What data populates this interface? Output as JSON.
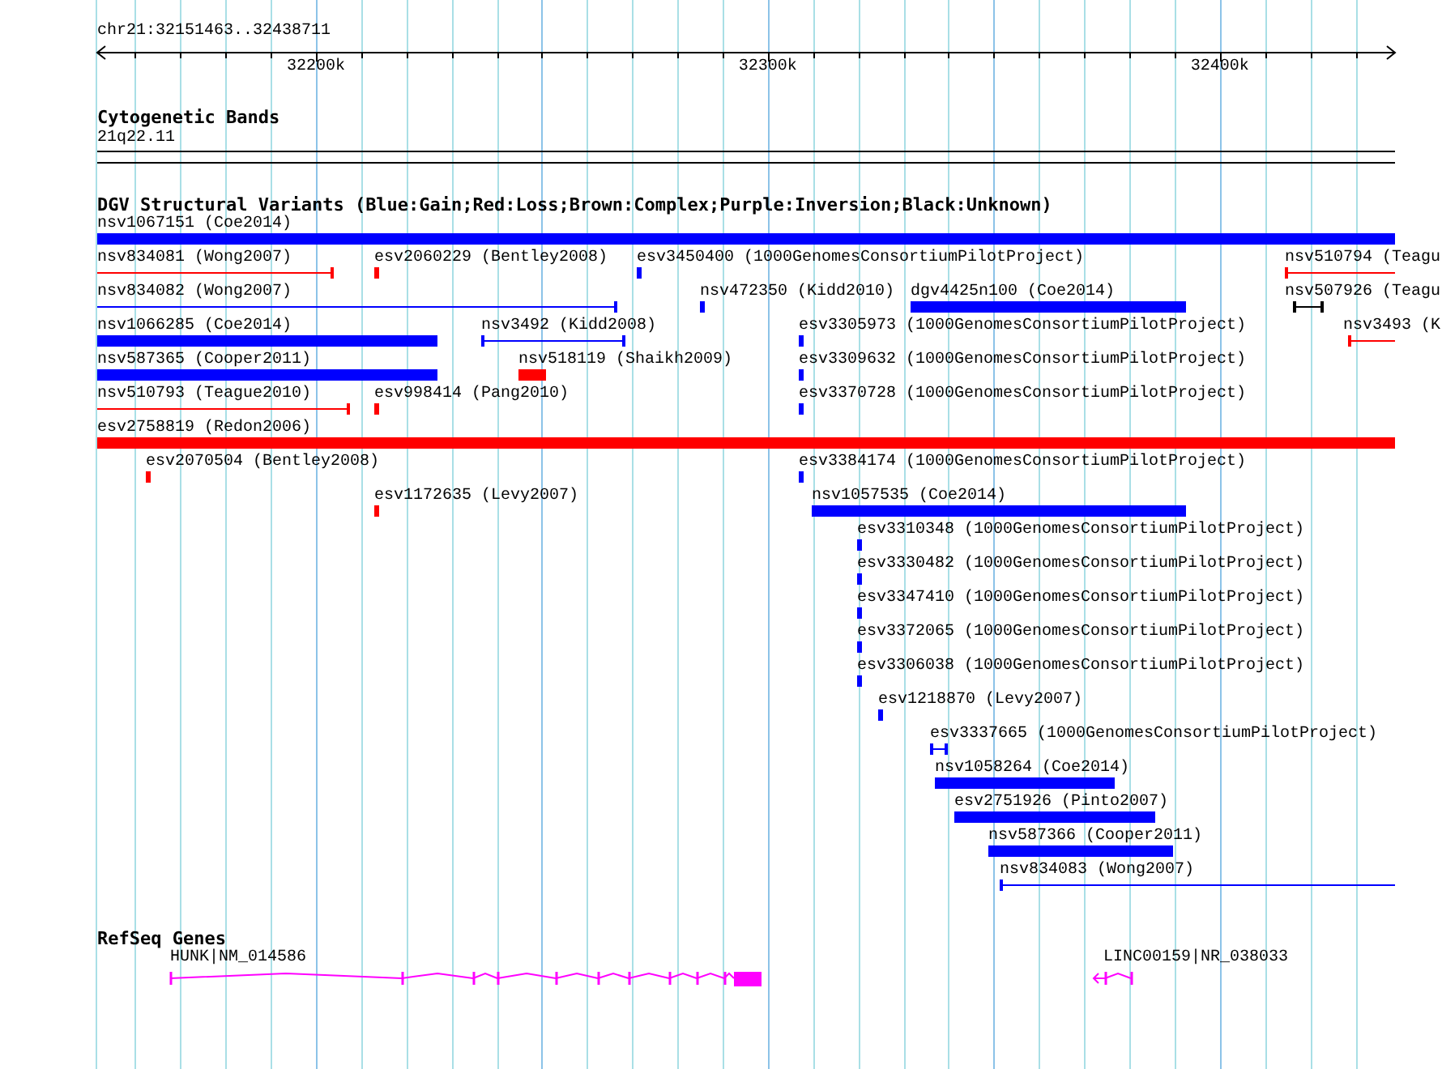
{
  "ruler": {
    "region": "chr21:32151463..32438711",
    "ticks": [
      "32200k",
      "32300k",
      "32400k"
    ]
  },
  "cytoband_track": {
    "title": "Cytogenetic Bands",
    "band": "21q22.11"
  },
  "variants_track": {
    "title": "DGV Structural Variants (Blue:Gain;Red:Loss;Brown:Complex;Purple:Inversion;Black:Unknown)",
    "rows": [
      {
        "features": [
          {
            "label": "nsv1067151 (Coe2014)",
            "color": "#0000ff",
            "kind": "bar"
          }
        ]
      },
      {
        "features": [
          {
            "label": "nsv834081 (Wong2007)",
            "color": "#ff0000",
            "kind": "span"
          },
          {
            "label": "esv2060229 (Bentley2008)",
            "color": "#ff0000",
            "kind": "bar"
          },
          {
            "label": "esv3450400 (1000GenomesConsortiumPilotProject)",
            "color": "#0000ff",
            "kind": "bar"
          },
          {
            "label": "nsv510794 (Teagu",
            "color": "#ff0000",
            "kind": "span"
          }
        ]
      },
      {
        "features": [
          {
            "label": "nsv834082 (Wong2007)",
            "color": "#0000ff",
            "kind": "span"
          },
          {
            "label": "nsv472350 (Kidd2010)",
            "color": "#0000ff",
            "kind": "bar"
          },
          {
            "label": "dgv4425n100 (Coe2014)",
            "color": "#0000ff",
            "kind": "bar"
          },
          {
            "label": "nsv507926 (Teagu",
            "color": "#000000",
            "kind": "span"
          }
        ]
      },
      {
        "features": [
          {
            "label": "nsv1066285 (Coe2014)",
            "color": "#0000ff",
            "kind": "bar"
          },
          {
            "label": "nsv3492 (Kidd2008)",
            "color": "#0000ff",
            "kind": "span"
          },
          {
            "label": "esv3305973 (1000GenomesConsortiumPilotProject)",
            "color": "#0000ff",
            "kind": "bar"
          },
          {
            "label": "nsv3493 (K",
            "color": "#ff0000",
            "kind": "span"
          }
        ]
      },
      {
        "features": [
          {
            "label": "nsv587365 (Cooper2011)",
            "color": "#0000ff",
            "kind": "bar"
          },
          {
            "label": "nsv518119 (Shaikh2009)",
            "color": "#ff0000",
            "kind": "bar"
          },
          {
            "label": "esv3309632 (1000GenomesConsortiumPilotProject)",
            "color": "#0000ff",
            "kind": "bar"
          }
        ]
      },
      {
        "features": [
          {
            "label": "nsv510793 (Teague2010)",
            "color": "#ff0000",
            "kind": "span"
          },
          {
            "label": "esv998414 (Pang2010)",
            "color": "#ff0000",
            "kind": "bar"
          },
          {
            "label": "esv3370728 (1000GenomesConsortiumPilotProject)",
            "color": "#0000ff",
            "kind": "bar"
          }
        ]
      },
      {
        "features": [
          {
            "label": "esv2758819 (Redon2006)",
            "color": "#ff0000",
            "kind": "bar"
          }
        ]
      },
      {
        "features": [
          {
            "label": "esv2070504 (Bentley2008)",
            "color": "#ff0000",
            "kind": "bar"
          },
          {
            "label": "esv3384174 (1000GenomesConsortiumPilotProject)",
            "color": "#0000ff",
            "kind": "bar"
          }
        ]
      },
      {
        "features": [
          {
            "label": "esv1172635 (Levy2007)",
            "color": "#ff0000",
            "kind": "bar"
          },
          {
            "label": "nsv1057535 (Coe2014)",
            "color": "#0000ff",
            "kind": "bar"
          }
        ]
      },
      {
        "features": [
          {
            "label": "esv3310348 (1000GenomesConsortiumPilotProject)",
            "color": "#0000ff",
            "kind": "bar"
          }
        ]
      },
      {
        "features": [
          {
            "label": "esv3330482 (1000GenomesConsortiumPilotProject)",
            "color": "#0000ff",
            "kind": "bar"
          }
        ]
      },
      {
        "features": [
          {
            "label": "esv3347410 (1000GenomesConsortiumPilotProject)",
            "color": "#0000ff",
            "kind": "bar"
          }
        ]
      },
      {
        "features": [
          {
            "label": "esv3372065 (1000GenomesConsortiumPilotProject)",
            "color": "#0000ff",
            "kind": "bar"
          }
        ]
      },
      {
        "features": [
          {
            "label": "esv3306038 (1000GenomesConsortiumPilotProject)",
            "color": "#0000ff",
            "kind": "bar"
          }
        ]
      },
      {
        "features": [
          {
            "label": "esv1218870 (Levy2007)",
            "color": "#0000ff",
            "kind": "bar"
          }
        ]
      },
      {
        "features": [
          {
            "label": "esv3337665 (1000GenomesConsortiumPilotProject)",
            "color": "#0000ff",
            "kind": "span"
          }
        ]
      },
      {
        "features": [
          {
            "label": "nsv1058264 (Coe2014)",
            "color": "#0000ff",
            "kind": "bar"
          }
        ]
      },
      {
        "features": [
          {
            "label": "esv2751926 (Pinto2007)",
            "color": "#0000ff",
            "kind": "bar"
          }
        ]
      },
      {
        "features": [
          {
            "label": "nsv587366 (Cooper2011)",
            "color": "#0000ff",
            "kind": "bar"
          }
        ]
      },
      {
        "features": [
          {
            "label": "nsv834083 (Wong2007)",
            "color": "#0000ff",
            "kind": "span"
          }
        ]
      }
    ]
  },
  "genes_track": {
    "title": "RefSeq Genes",
    "genes": [
      {
        "label": "HUNK|NM_014586"
      },
      {
        "label": "LINC00159|NR_038033"
      }
    ]
  }
}
